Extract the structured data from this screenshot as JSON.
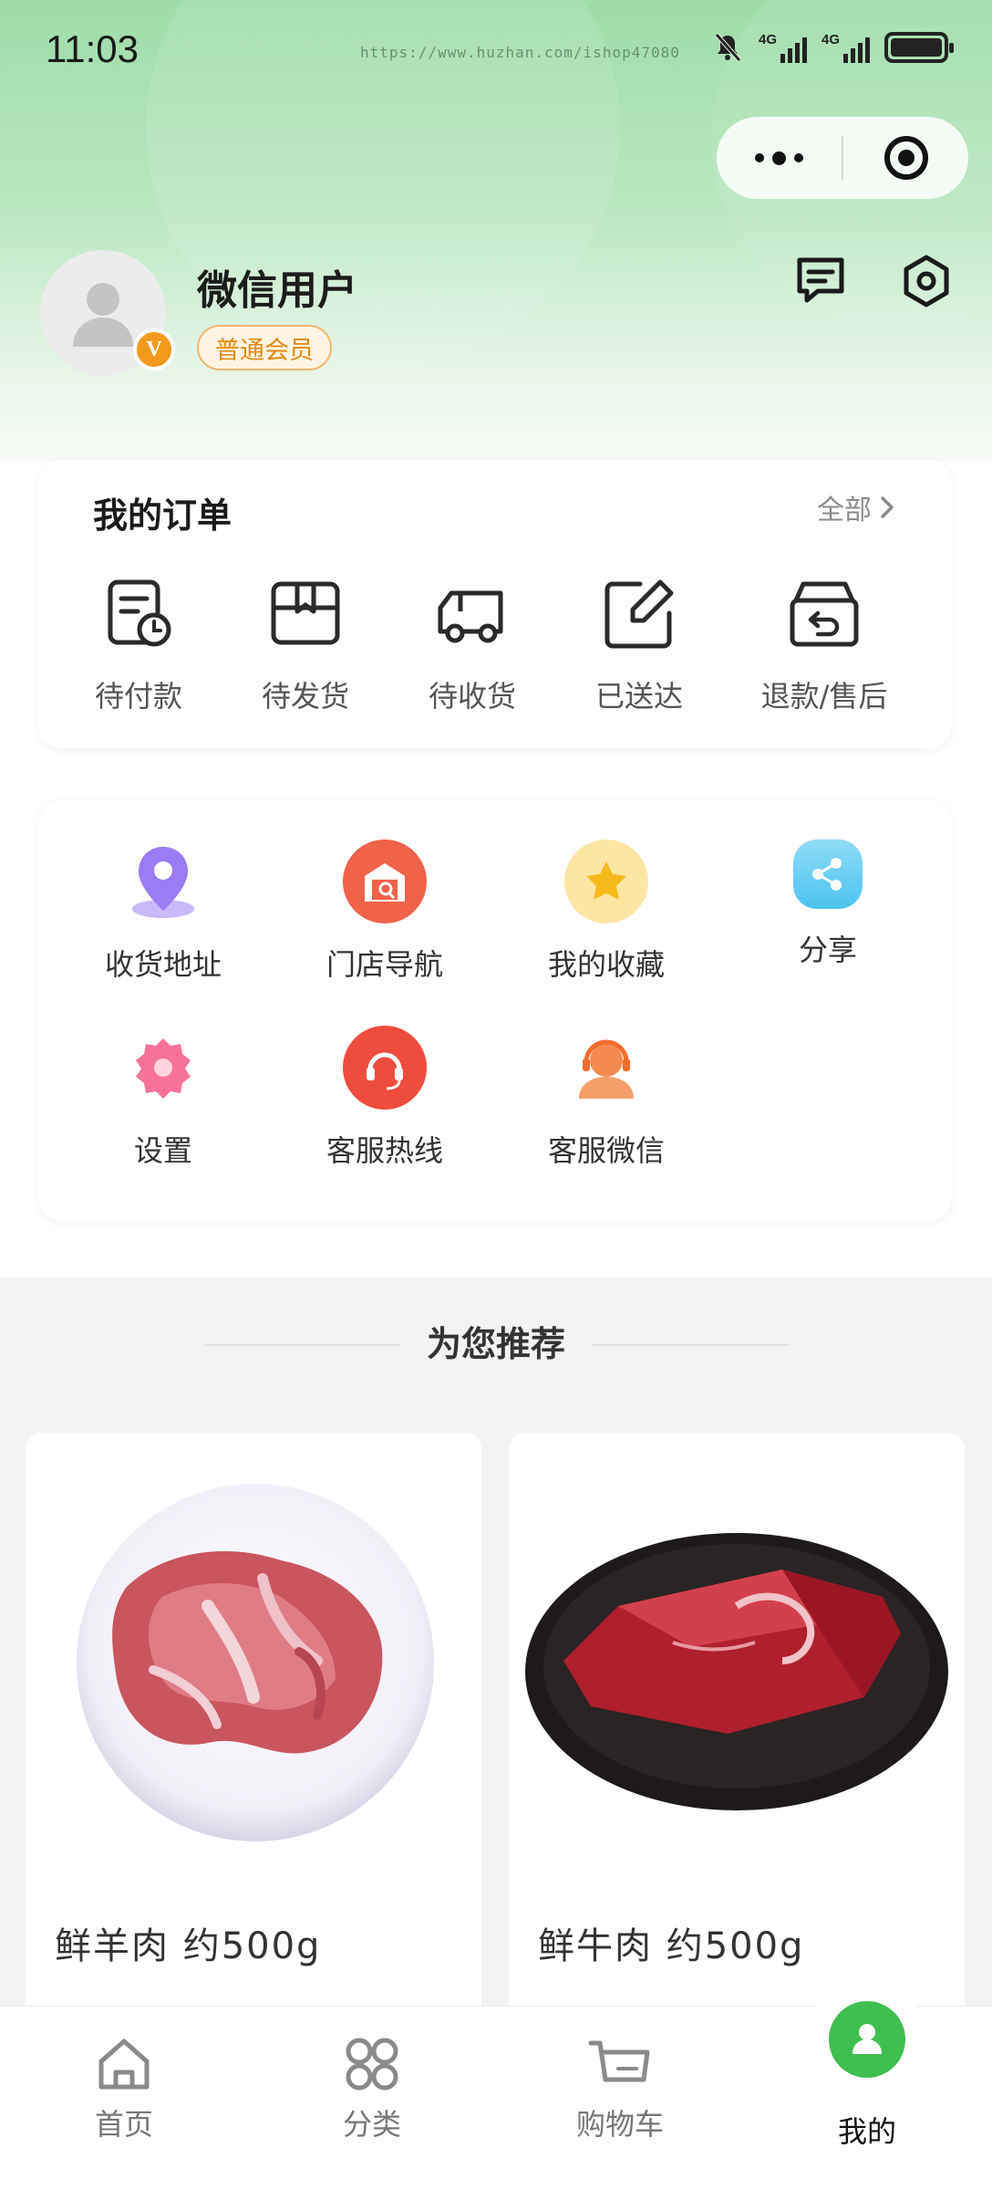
{
  "status_bar": {
    "time": "11:03",
    "url": "https://www.huzhan.com/ishop47080",
    "signal_1": "4G",
    "signal_2": "4G"
  },
  "header": {
    "user_name": "微信用户",
    "member_level": "普通会员",
    "badge_letter": "V"
  },
  "orders": {
    "title": "我的订单",
    "all_label": "全部",
    "items": [
      {
        "label": "待付款",
        "icon": "pending-payment-icon"
      },
      {
        "label": "待发货",
        "icon": "pending-shipment-icon"
      },
      {
        "label": "待收货",
        "icon": "pending-receipt-icon"
      },
      {
        "label": "已送达",
        "icon": "delivered-icon"
      },
      {
        "label": "退款/售后",
        "icon": "refund-icon"
      }
    ]
  },
  "tools": [
    {
      "label": "收货地址",
      "icon": "location-icon",
      "color": "#9b7cf5"
    },
    {
      "label": "门店导航",
      "icon": "store-icon",
      "color": "#f0624a"
    },
    {
      "label": "我的收藏",
      "icon": "star-icon",
      "color": "#f8c93a"
    },
    {
      "label": "分享",
      "icon": "share-icon",
      "color": "#4cc3f0"
    },
    {
      "label": "设置",
      "icon": "settings-icon",
      "color": "#f7729a"
    },
    {
      "label": "客服热线",
      "icon": "hotline-icon",
      "color": "#ee4d3e"
    },
    {
      "label": "客服微信",
      "icon": "customer-service-icon",
      "color": "#f58b4e"
    }
  ],
  "recommend": {
    "title": "为您推荐",
    "products": [
      {
        "name": "鲜羊肉 约500g"
      },
      {
        "name": "鲜牛肉 约500g"
      }
    ]
  },
  "tabbar": {
    "items": [
      {
        "label": "首页",
        "icon": "home-icon"
      },
      {
        "label": "分类",
        "icon": "category-icon"
      },
      {
        "label": "购物车",
        "icon": "cart-icon"
      },
      {
        "label": "我的",
        "icon": "user-icon",
        "active": true
      }
    ]
  },
  "colors": {
    "brand_green": "#3fbf4f",
    "member_orange": "#e48a14"
  }
}
